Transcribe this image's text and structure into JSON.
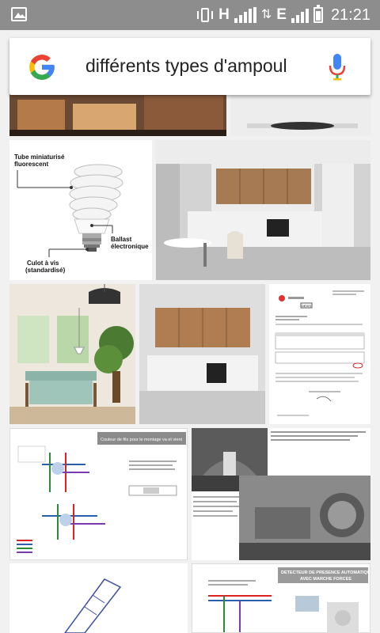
{
  "status_bar": {
    "network_label": "H",
    "network_label_2": "E",
    "time": "21:21",
    "icons": [
      "gallery-icon",
      "vibrate-icon",
      "signal-icon",
      "data-arrows-icon",
      "battery-icon"
    ]
  },
  "search": {
    "query": "différents types d'ampoul",
    "logo": "google-g-icon",
    "mic": "microphone-icon"
  },
  "results": {
    "bulb_labels": {
      "tube": "Tube miniaturisé\nfluorescent",
      "ballast": "Ballast\nélectronique",
      "culot": "Culot à vis\n(standardisé)"
    },
    "wiring_title": "Couleur de fils pour le montage va et vient",
    "detector_title": "DETECTEUR DE PRESENCE AUTOMATIQUE\nAVEC MARCHE FORCEE",
    "doc_header": "DEVIS"
  },
  "colors": {
    "status_bar": "#8d8d8d",
    "google_blue": "#4285F4",
    "google_red": "#EA4335",
    "google_yellow": "#FBBC05",
    "google_green": "#34A853"
  }
}
